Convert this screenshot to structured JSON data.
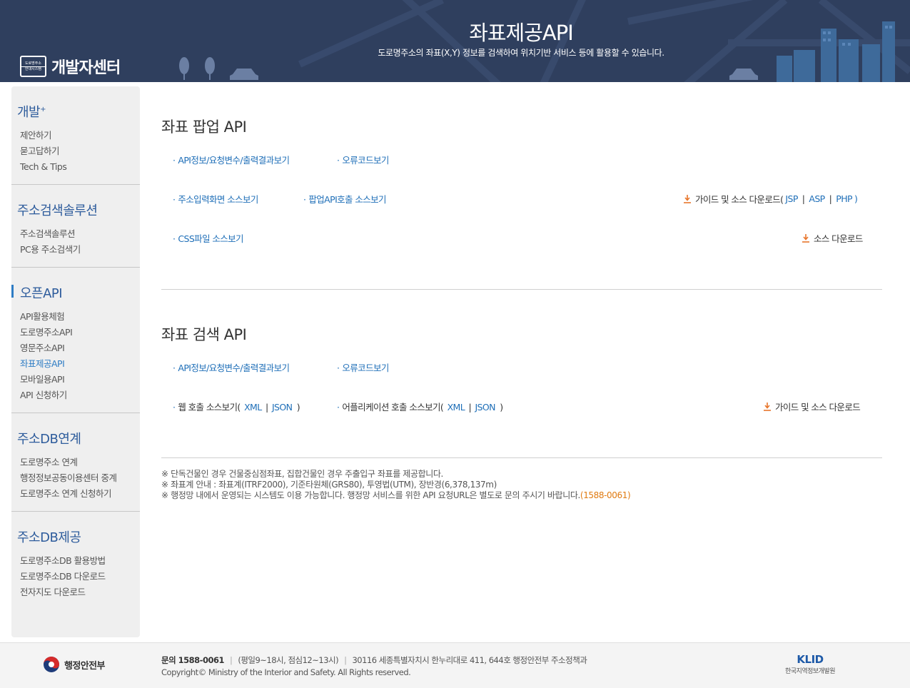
{
  "header": {
    "logo_badge_top": "도로명주소",
    "logo_badge_bottom": "안내시스템",
    "logo_text": "개발자센터",
    "title": "좌표제공API",
    "subtitle": "도로명주소의 좌표(X,Y) 정보를 검색하여 위치기반 서비스 등에 활용할 수 있습니다."
  },
  "sidebar": {
    "groups": [
      {
        "title": "개발",
        "title_sup": "+",
        "items": [
          "제안하기",
          "묻고답하기",
          "Tech & Tips"
        ]
      },
      {
        "title": "주소검색솔루션",
        "items": [
          "주소검색솔루션",
          "PC용 주소검색기"
        ]
      },
      {
        "title": "오픈API",
        "items": [
          "API활용체험",
          "도로명주소API",
          "영문주소API",
          "좌표제공API",
          "모바일용API",
          "API 신청하기"
        ]
      },
      {
        "title": "주소DB연계",
        "items": [
          "도로명주소 연계",
          "행정정보공동이용센터 중계",
          "도로명주소 연계 신청하기"
        ]
      },
      {
        "title": "주소DB제공",
        "items": [
          "도로명주소DB 활용방법",
          "도로명주소DB 다운로드",
          "전자지도 다운로드"
        ]
      }
    ]
  },
  "popup_section": {
    "title": "좌표 팝업 API",
    "link_api_info": "API정보/요청변수/출력결과보기",
    "link_error_code": "오류코드보기",
    "link_input_source": "주소입력화면 소스보기",
    "link_popup_call_source": "팝업API호출 소스보기",
    "link_css_source": "CSS파일 소스보기",
    "guide_download": "가이드 및 소스 다운로드(",
    "guide_jsp": "JSP",
    "guide_asp": "ASP",
    "guide_php": "PHP",
    "guide_sep": "|",
    "guide_close": ")",
    "source_download": "소스 다운로드"
  },
  "search_section": {
    "title": "좌표 검색 API",
    "link_api_info": "API정보/요청변수/출력결과보기",
    "link_error_code": "오류코드보기",
    "web_call_label": "웹 호출 소스보기(",
    "app_call_label": "어플리케이션 호출 소스보기(",
    "xml": "XML",
    "json": "JSON",
    "sep": "|",
    "close": ")",
    "guide_download": "가이드 및 소스 다운로드"
  },
  "notes": {
    "line1": "※ 단독건물인 경우 건물중심점좌표, 집합건물인 경우 주출입구 좌표를 제공합니다.",
    "line2": "※ 좌표계 안내 : 좌표계(ITRF2000), 기준타원체(GRS80), 투영법(UTM), 장반경(6,378,137m)",
    "line3": "※ 행정망 내에서 운영되는 시스템도 이용 가능합니다. 행정망 서비스를 위한 API 요청URL은 별도로 문의 주시기 바랍니다.",
    "line3_phone": "(1588-0061)"
  },
  "footer": {
    "gov_name": "행정안전부",
    "contact": "문의 1588-0061",
    "hours": "(평일9~18시, 점심12~13시)",
    "address": "30116 세종특별자치시 한누리대로 411, 644호 행정안전부 주소정책과",
    "copyright": "Copyright© Ministry of the Interior and Safety. All Rights reserved.",
    "klid_logo": "KLID",
    "klid_name": "한국지역정보개발원"
  },
  "colors": {
    "header_bg": "#2f3f5e",
    "link_blue": "#1f6fb8",
    "download_orange": "#e8762c",
    "phone_orange": "#e07a10"
  }
}
